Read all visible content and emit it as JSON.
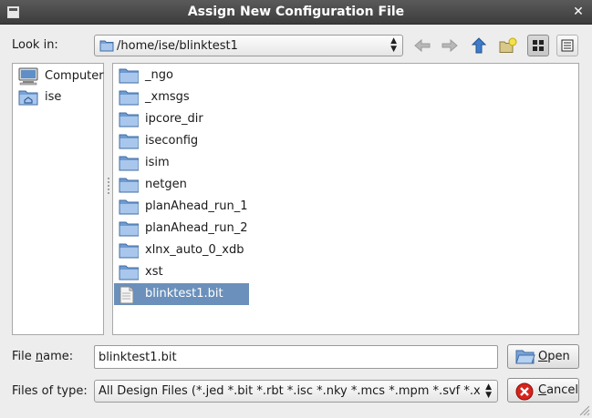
{
  "window": {
    "title": "Assign New Configuration File"
  },
  "look_in": {
    "label": "Look in:",
    "path": "/home/ise/blinktest1"
  },
  "toolbar": {
    "back": "go-back-icon",
    "forward": "go-forward-icon",
    "up": "go-up-icon",
    "new_folder": "new-folder-icon",
    "icon_view": "icon-view-icon",
    "detail_view": "detail-view-icon"
  },
  "sidebar": {
    "items": [
      {
        "label": "Computer",
        "icon": "computer-icon"
      },
      {
        "label": "ise",
        "icon": "home-folder-icon"
      }
    ]
  },
  "files": [
    {
      "name": "_ngo",
      "type": "folder"
    },
    {
      "name": "_xmsgs",
      "type": "folder"
    },
    {
      "name": "ipcore_dir",
      "type": "folder"
    },
    {
      "name": "iseconfig",
      "type": "folder"
    },
    {
      "name": "isim",
      "type": "folder"
    },
    {
      "name": "netgen",
      "type": "folder"
    },
    {
      "name": "planAhead_run_1",
      "type": "folder"
    },
    {
      "name": "planAhead_run_2",
      "type": "folder"
    },
    {
      "name": "xlnx_auto_0_xdb",
      "type": "folder"
    },
    {
      "name": "xst",
      "type": "folder"
    },
    {
      "name": "blinktest1.bit",
      "type": "file",
      "selected": true
    }
  ],
  "file_name": {
    "label_pre": "File ",
    "label_accel": "n",
    "label_post": "ame:",
    "value": "blinktest1.bit"
  },
  "file_type": {
    "label": "Files of type:",
    "value": "All Design Files (*.jed *.bit *.rbt *.isc *.nky *.mcs *.mpm *.svf *.xsvf)"
  },
  "buttons": {
    "open": {
      "accel": "O",
      "rest": "pen"
    },
    "cancel": {
      "accel": "C",
      "rest": "ancel"
    }
  },
  "colors": {
    "selection": "#6a90bb",
    "folder": "#6f9bd0",
    "titlebar": "#4a4a4a"
  }
}
